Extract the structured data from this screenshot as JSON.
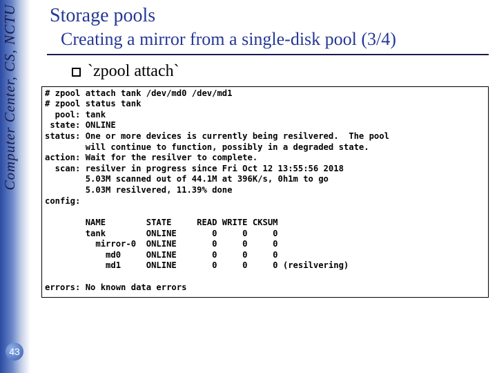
{
  "sidebar": {
    "org": "Computer Center, CS, NCTU",
    "page_number": "43"
  },
  "header": {
    "title": "Storage pools",
    "subtitle": "Creating a mirror from a single-disk pool (3/4)"
  },
  "bullet": {
    "text": "`zpool attach`"
  },
  "terminal": {
    "line01": "# zpool attach tank /dev/md0 /dev/md1",
    "line02": "# zpool status tank",
    "line03": "  pool: tank",
    "line04": " state: ONLINE",
    "line05": "status: One or more devices is currently being resilvered.  The pool",
    "line06": "        will continue to function, possibly in a degraded state.",
    "line07": "action: Wait for the resilver to complete.",
    "line08": "  scan: resilver in progress since Fri Oct 12 13:55:56 2018",
    "line09": "        5.03M scanned out of 44.1M at 396K/s, 0h1m to go",
    "line10": "        5.03M resilvered, 11.39% done",
    "line11": "config:",
    "line12": "",
    "line13": "        NAME        STATE     READ WRITE CKSUM",
    "line14": "        tank        ONLINE       0     0     0",
    "line15": "          mirror-0  ONLINE       0     0     0",
    "line16": "            md0     ONLINE       0     0     0",
    "line17": "            md1     ONLINE       0     0     0 (resilvering)",
    "line18": "",
    "line19": "errors: No known data errors"
  }
}
